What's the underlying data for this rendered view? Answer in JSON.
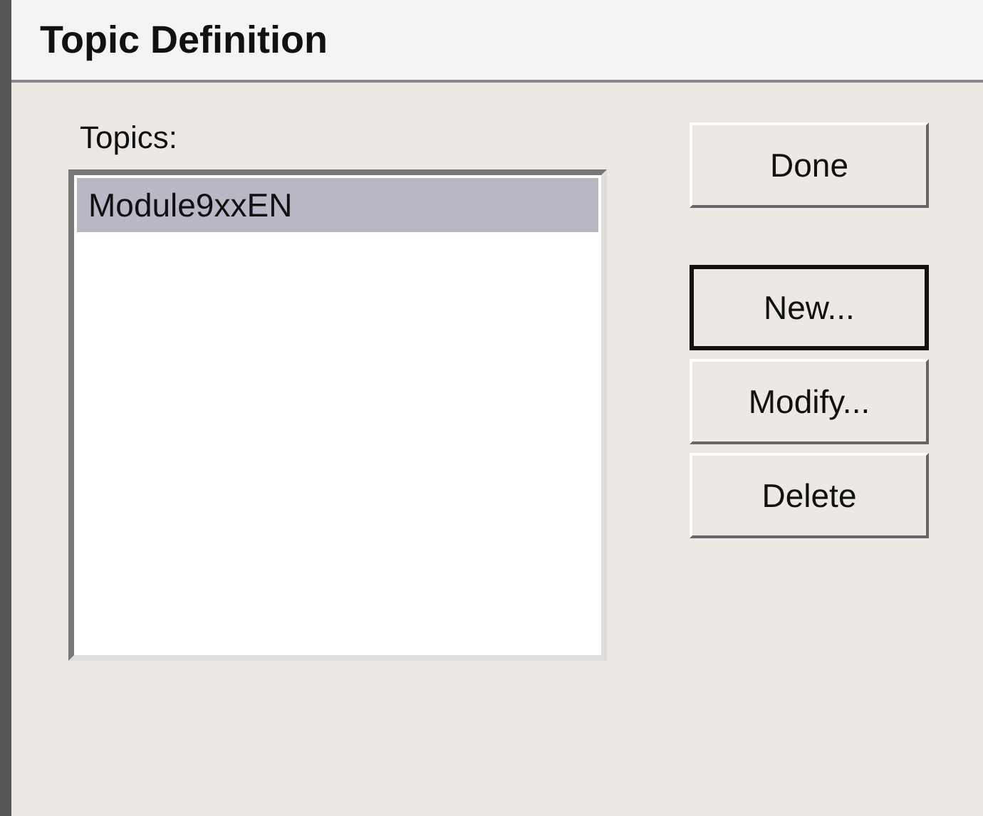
{
  "window": {
    "title": "Topic Definition"
  },
  "topics": {
    "label": "Topics:",
    "items": [
      {
        "label": "Module9xxEN",
        "selected": true
      }
    ]
  },
  "buttons": [
    {
      "label": "Done",
      "default": false
    },
    {
      "label": "New...",
      "default": true
    },
    {
      "label": "Modify...",
      "default": false
    },
    {
      "label": "Delete",
      "default": false
    }
  ]
}
